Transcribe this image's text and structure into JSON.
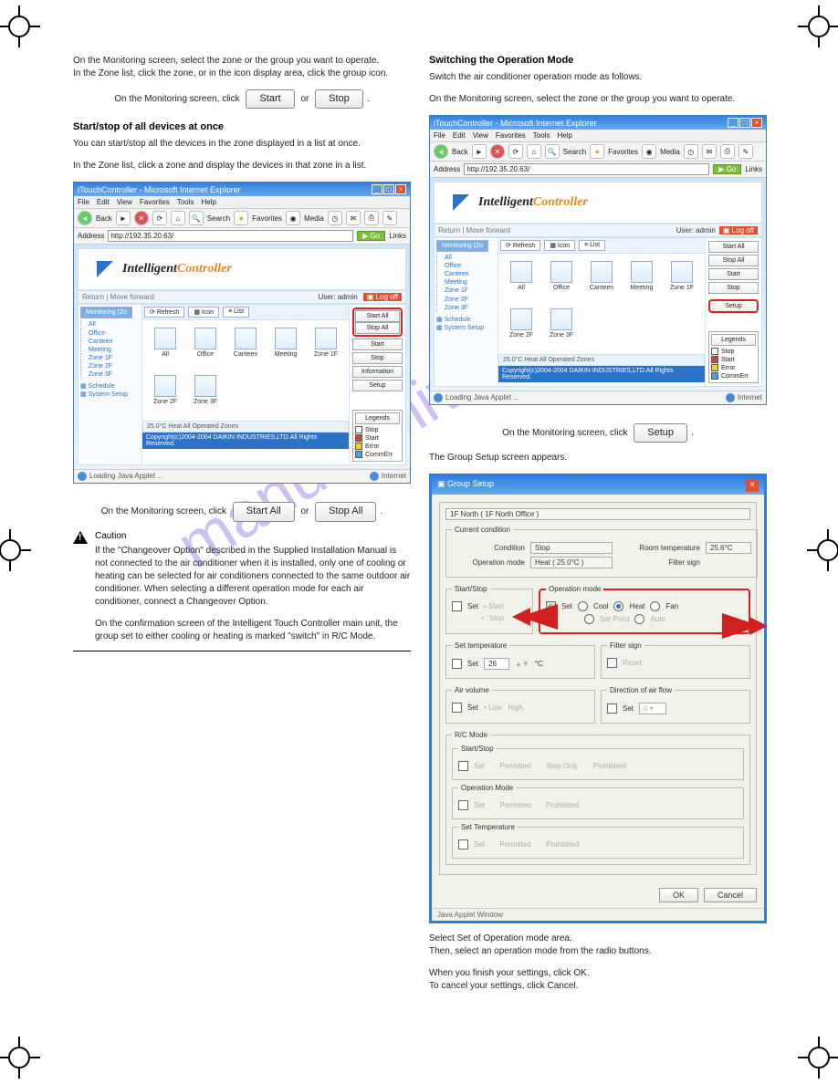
{
  "buttons": {
    "start": "Start",
    "stop": "Stop",
    "start_all": "Start All",
    "stop_all": "Stop All",
    "setup": "Setup",
    "ok": "OK",
    "cancel": "Cancel",
    "go": "Go",
    "links": "Links"
  },
  "headings": {
    "startstop_all": "Start/stop of all devices at once",
    "startstop_all_desc": "You can start/stop all the devices in the zone displayed in a list at once.",
    "switch_op": "Switching the Operation Mode",
    "switch_op_desc": "Switch the air conditioner operation mode as follows."
  },
  "left_steps": {
    "s1a": "On the Monitoring screen, select the zone or the group you want to operate.",
    "s1b": "In the Zone list, click the zone, or in the icon display area, click the group icon.",
    "s2": "On the Monitoring screen, click",
    "s3": "or",
    "all_a": "In the Zone list, click a zone and display the devices in that zone in a list.",
    "all_b": "On the Monitoring screen, click"
  },
  "caution": {
    "label": "Caution",
    "text": "If the \"Changeover Option\" described in the Supplied Installation Manual is not connected to the air conditioner when it is installed, only one of cooling or heating can be selected for air conditioners connected to the same outdoor air conditioner. When selecting a different operation mode for each air conditioner, connect a Changeover Option.",
    "sub": "On the confirmation screen of the Intelligent Touch Controller main unit, the group set to either cooling or heating is marked \"switch\" in R/C Mode."
  },
  "right_steps": {
    "s1": "On the Monitoring screen, select the zone or the group you want to operate.",
    "s2a": "On the Monitoring screen, click",
    "s2b": "The Group Setup screen appears.",
    "s3a": "Select Set of Operation mode area.",
    "s3b": "Then, select an operation mode from the radio buttons.",
    "s4a": "When you finish your settings, click OK.",
    "s4b": "To cancel your settings, click Cancel."
  },
  "browser": {
    "title": "iTouchController - Microsoft Internet Explorer",
    "menus": [
      "File",
      "Edit",
      "View",
      "Favorites",
      "Tools",
      "Help"
    ],
    "back": "Back",
    "search": "Search",
    "favorites": "Favorites",
    "media": "Media",
    "address_lbl": "Address",
    "address_val": "http://192.35.20.63/",
    "brand_a": "Intelligent",
    "brand_b": "Controller",
    "tab_return": "Return",
    "tab_move": "Move forward",
    "user_label": "User:",
    "user_val": "admin",
    "logoff": "Log off",
    "footer_loading": "Loading Java Applet ...",
    "footer_net": "Internet"
  },
  "monitoring": {
    "tab": "Monitoring (Zo",
    "refresh": "Refresh",
    "icon": "Icon",
    "list": "List",
    "tree_root": "-",
    "tree": [
      "All",
      "Office",
      "Canteen",
      "Meeting",
      "Zone 1F",
      "Zone 2F",
      "Zone 3F"
    ],
    "tree_extra": [
      "Schedule",
      "System Setup"
    ],
    "icons": [
      "All",
      "Office",
      "Canteen",
      "Meeting",
      "Zone 1F",
      "Zone 2F",
      "Zone 3F"
    ],
    "side": [
      "Start All",
      "Stop All",
      "Start",
      "Stop",
      "Information",
      "Setup"
    ],
    "side2": [
      "Start All",
      "Stop All",
      "Start",
      "Stop",
      "Setup"
    ],
    "legends_lbl": "Legends",
    "legends": [
      "Stop",
      "Start",
      "Error",
      "CommErr"
    ],
    "legend_colors": [
      "#ffffff",
      "#c94a3a",
      "#e8d23a",
      "#4aa3e0"
    ],
    "zone_status": "25.0°C Heat All Operated Zones",
    "copyright": "Copyright(c)2004-2004 DAIKIN INDUSTRIES,LTD.All Rights Reserved."
  },
  "dialog": {
    "title": "Group Setup",
    "group_name": "1F North ( 1F North Office )",
    "current_cond": "Current condition",
    "condition_lbl": "Condition",
    "condition_val": "Stop",
    "roomtemp_lbl": "Room temperature",
    "roomtemp_val": "25.6°C",
    "opmode_lbl": "Operation mode",
    "opmode_val": "Heat ( 25.0°C )",
    "filter_lbl": "Filter sign",
    "ss": "Start/Stop",
    "set": "Set",
    "start": "Start",
    "stop": "Stop",
    "opmode_sec": "Operation mode",
    "cool": "Cool",
    "heat": "Heat",
    "fan": "Fan",
    "setpoint": "Set Point",
    "auto": "Auto",
    "settemp": "Set temperature",
    "temp_val": "26",
    "deg": "°C",
    "filtersec": "Filter sign",
    "reset": "Reset",
    "airvol": "Air volume",
    "low": "Low",
    "high": "High",
    "airdir": "Direction of air flow",
    "rcmode": "R/C Mode",
    "permitted": "Permitted",
    "stoponly": "Stop Only",
    "prohibited": "Prohibited",
    "opmode_rc": "Operation Mode",
    "settemp_rc": "Set Temperature",
    "java": "Java Applet Window"
  }
}
